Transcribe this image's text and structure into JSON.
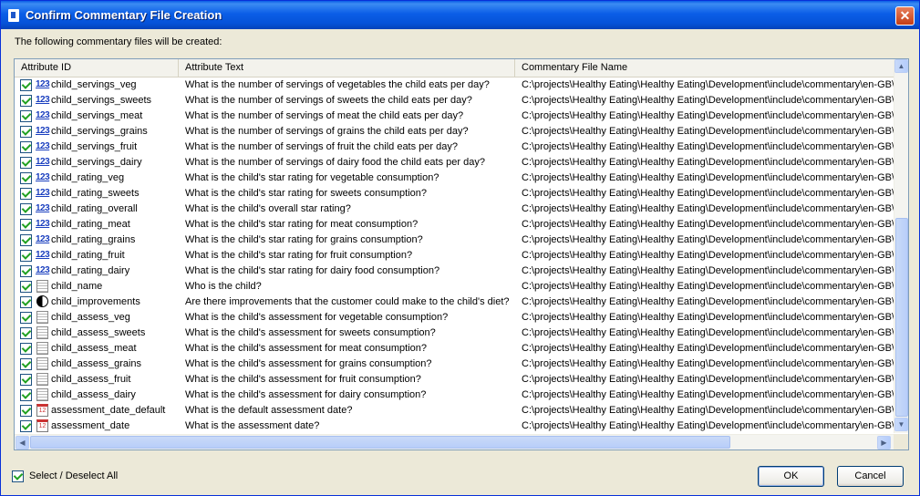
{
  "window": {
    "title": "Confirm Commentary File Creation",
    "close_label": "✕"
  },
  "intro": "The following commentary files will be created:",
  "columns": [
    "Attribute ID",
    "Attribute Text",
    "Commentary File Name"
  ],
  "rows": [
    {
      "icon": "numeric-icon",
      "id": "child_servings_veg",
      "text": "What is the number of servings of vegetables the child eats per day?",
      "file": "C:\\projects\\Healthy Eating\\Healthy Eating\\Development\\include\\commentary\\en-GB\\",
      "checked": true
    },
    {
      "icon": "numeric-icon",
      "id": "child_servings_sweets",
      "text": "What is the number of servings of sweets the child eats per day?",
      "file": "C:\\projects\\Healthy Eating\\Healthy Eating\\Development\\include\\commentary\\en-GB\\",
      "checked": true
    },
    {
      "icon": "numeric-icon",
      "id": "child_servings_meat",
      "text": "What is the number of servings of meat the child eats per day?",
      "file": "C:\\projects\\Healthy Eating\\Healthy Eating\\Development\\include\\commentary\\en-GB\\",
      "checked": true
    },
    {
      "icon": "numeric-icon",
      "id": "child_servings_grains",
      "text": "What is the number of servings of grains the child eats per day?",
      "file": "C:\\projects\\Healthy Eating\\Healthy Eating\\Development\\include\\commentary\\en-GB\\",
      "checked": true
    },
    {
      "icon": "numeric-icon",
      "id": "child_servings_fruit",
      "text": "What is the number of servings of fruit the child eats per day?",
      "file": "C:\\projects\\Healthy Eating\\Healthy Eating\\Development\\include\\commentary\\en-GB\\",
      "checked": true
    },
    {
      "icon": "numeric-icon",
      "id": "child_servings_dairy",
      "text": "What is the number of servings of dairy food the child eats per day?",
      "file": "C:\\projects\\Healthy Eating\\Healthy Eating\\Development\\include\\commentary\\en-GB\\",
      "checked": true
    },
    {
      "icon": "numeric-icon",
      "id": "child_rating_veg",
      "text": "What is the child's star rating for vegetable consumption?",
      "file": "C:\\projects\\Healthy Eating\\Healthy Eating\\Development\\include\\commentary\\en-GB\\",
      "checked": true
    },
    {
      "icon": "numeric-icon",
      "id": "child_rating_sweets",
      "text": "What is the child's star rating for sweets consumption?",
      "file": "C:\\projects\\Healthy Eating\\Healthy Eating\\Development\\include\\commentary\\en-GB\\",
      "checked": true
    },
    {
      "icon": "numeric-icon",
      "id": "child_rating_overall",
      "text": "What is the child's overall star rating?",
      "file": "C:\\projects\\Healthy Eating\\Healthy Eating\\Development\\include\\commentary\\en-GB\\",
      "checked": true
    },
    {
      "icon": "numeric-icon",
      "id": "child_rating_meat",
      "text": "What is the child's star rating for meat consumption?",
      "file": "C:\\projects\\Healthy Eating\\Healthy Eating\\Development\\include\\commentary\\en-GB\\",
      "checked": true
    },
    {
      "icon": "numeric-icon",
      "id": "child_rating_grains",
      "text": "What is the child's star rating for grains consumption?",
      "file": "C:\\projects\\Healthy Eating\\Healthy Eating\\Development\\include\\commentary\\en-GB\\",
      "checked": true
    },
    {
      "icon": "numeric-icon",
      "id": "child_rating_fruit",
      "text": "What is the child's star rating for fruit consumption?",
      "file": "C:\\projects\\Healthy Eating\\Healthy Eating\\Development\\include\\commentary\\en-GB\\",
      "checked": true
    },
    {
      "icon": "numeric-icon",
      "id": "child_rating_dairy",
      "text": "What is the child's star rating for dairy food consumption?",
      "file": "C:\\projects\\Healthy Eating\\Healthy Eating\\Development\\include\\commentary\\en-GB\\",
      "checked": true
    },
    {
      "icon": "text-icon",
      "id": "child_name",
      "text": "Who is the child?",
      "file": "C:\\projects\\Healthy Eating\\Healthy Eating\\Development\\include\\commentary\\en-GB\\",
      "checked": true
    },
    {
      "icon": "yin-yang-icon",
      "id": "child_improvements",
      "text": "Are there improvements that the customer could make to the child's diet?",
      "file": "C:\\projects\\Healthy Eating\\Healthy Eating\\Development\\include\\commentary\\en-GB\\",
      "checked": true
    },
    {
      "icon": "text-icon",
      "id": "child_assess_veg",
      "text": "What is the child's assessment for vegetable consumption?",
      "file": "C:\\projects\\Healthy Eating\\Healthy Eating\\Development\\include\\commentary\\en-GB\\",
      "checked": true
    },
    {
      "icon": "text-icon",
      "id": "child_assess_sweets",
      "text": "What is the child's assessment for sweets consumption?",
      "file": "C:\\projects\\Healthy Eating\\Healthy Eating\\Development\\include\\commentary\\en-GB\\",
      "checked": true
    },
    {
      "icon": "text-icon",
      "id": "child_assess_meat",
      "text": "What is the child's assessment for meat consumption?",
      "file": "C:\\projects\\Healthy Eating\\Healthy Eating\\Development\\include\\commentary\\en-GB\\",
      "checked": true
    },
    {
      "icon": "text-icon",
      "id": "child_assess_grains",
      "text": "What is the child's assessment for grains consumption?",
      "file": "C:\\projects\\Healthy Eating\\Healthy Eating\\Development\\include\\commentary\\en-GB\\",
      "checked": true
    },
    {
      "icon": "text-icon",
      "id": "child_assess_fruit",
      "text": "What is the child's assessment for fruit consumption?",
      "file": "C:\\projects\\Healthy Eating\\Healthy Eating\\Development\\include\\commentary\\en-GB\\",
      "checked": true
    },
    {
      "icon": "text-icon",
      "id": "child_assess_dairy",
      "text": "What is the child's assessment for dairy consumption?",
      "file": "C:\\projects\\Healthy Eating\\Healthy Eating\\Development\\include\\commentary\\en-GB\\",
      "checked": true
    },
    {
      "icon": "calendar-icon",
      "id": "assessment_date_default",
      "text": "What is the default assessment date?",
      "file": "C:\\projects\\Healthy Eating\\Healthy Eating\\Development\\include\\commentary\\en-GB\\",
      "checked": true
    },
    {
      "icon": "calendar-icon",
      "id": "assessment_date",
      "text": "What is the assessment date?",
      "file": "C:\\projects\\Healthy Eating\\Healthy Eating\\Development\\include\\commentary\\en-GB\\",
      "checked": true
    }
  ],
  "icon_glyphs": {
    "numeric-icon": "123",
    "calendar-icon": "12"
  },
  "footer": {
    "select_all_label": "Select / Deselect All",
    "select_all_checked": true,
    "ok_label": "OK",
    "cancel_label": "Cancel"
  },
  "colors": {
    "title_bar": "#0a5de6",
    "check": "#21a121",
    "close_button": "#c43d14"
  }
}
